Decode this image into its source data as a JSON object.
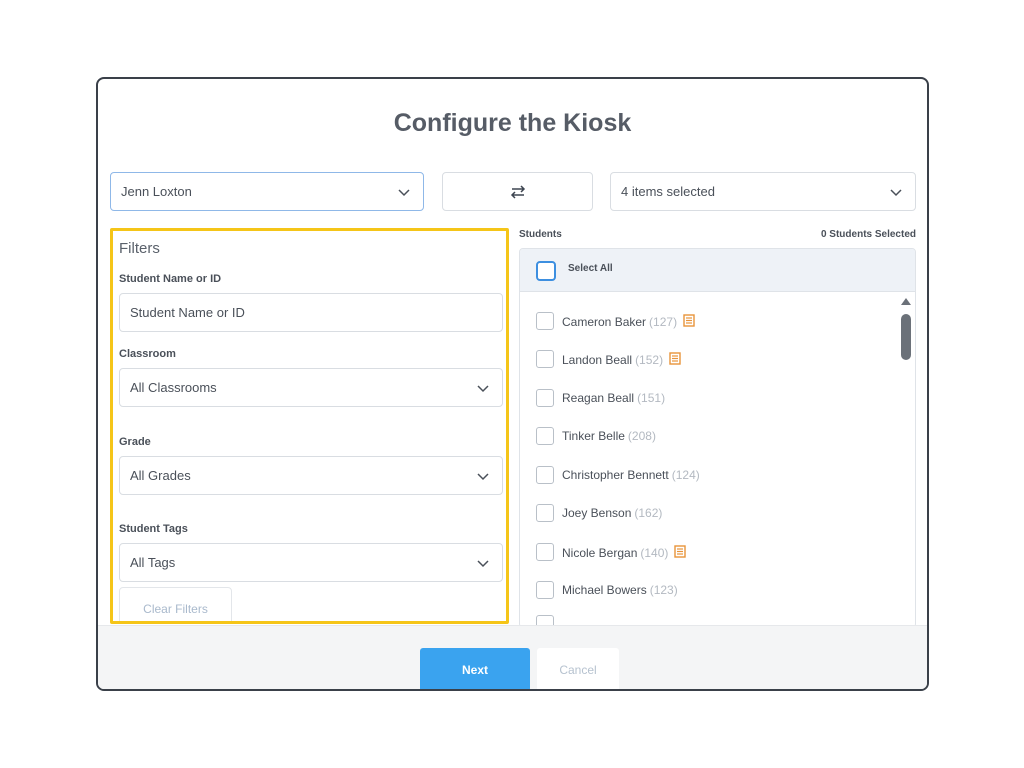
{
  "title": "Configure the Kiosk",
  "top_bar": {
    "staff_select": "Jenn Loxton",
    "swap_icon": "swap-arrows-icon",
    "items_select": "4 items selected"
  },
  "filters": {
    "title": "Filters",
    "name_label": "Student Name or ID",
    "name_placeholder": "Student Name or ID",
    "classroom_label": "Classroom",
    "classroom_value": "All Classrooms",
    "grade_label": "Grade",
    "grade_value": "All Grades",
    "tags_label": "Student Tags",
    "tags_value": "All Tags",
    "clear_label": "Clear Filters"
  },
  "students": {
    "header": "Students",
    "selected_count": "0 Students Selected",
    "select_all": "Select All",
    "list": [
      {
        "name": "Cameron Baker",
        "id": "(127)",
        "note": true
      },
      {
        "name": "Landon Beall",
        "id": "(152)",
        "note": true
      },
      {
        "name": "Reagan Beall",
        "id": "(151)",
        "note": false
      },
      {
        "name": "Tinker Belle",
        "id": "(208)",
        "note": false
      },
      {
        "name": "Christopher Bennett",
        "id": "(124)",
        "note": false
      },
      {
        "name": "Joey Benson",
        "id": "(162)",
        "note": false
      },
      {
        "name": "Nicole Bergan",
        "id": "(140)",
        "note": true
      },
      {
        "name": "Michael Bowers",
        "id": "(123)",
        "note": false
      }
    ]
  },
  "footer": {
    "next_label": "Next",
    "cancel_label": "Cancel"
  },
  "colors": {
    "filter_highlight": "#f5c518",
    "primary_button": "#3aa3ef",
    "note_icon": "#e8943a"
  }
}
